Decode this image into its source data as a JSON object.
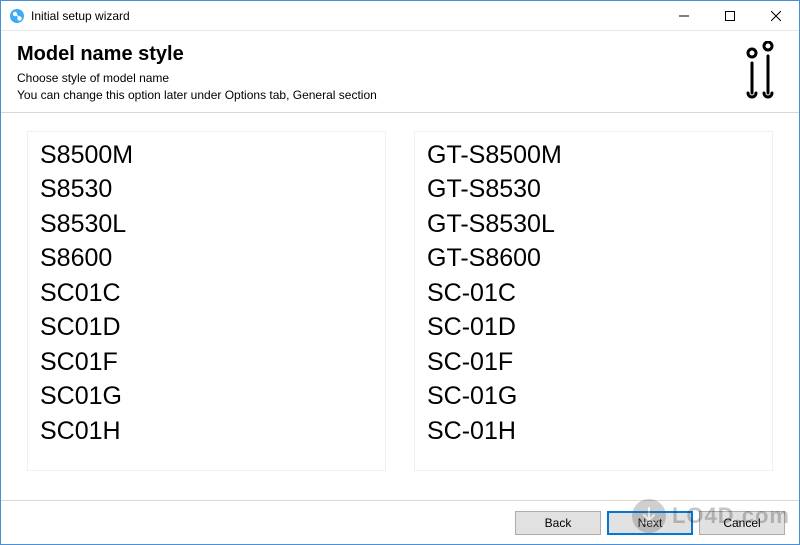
{
  "window": {
    "title": "Initial setup wizard"
  },
  "header": {
    "heading": "Model name style",
    "sub1": "Choose style of model name",
    "sub2": "You can change this option later under Options tab, General section"
  },
  "options": {
    "left": [
      "S8500M",
      "S8530",
      "S8530L",
      "S8600",
      "SC01C",
      "SC01D",
      "SC01F",
      "SC01G",
      "SC01H"
    ],
    "right": [
      "GT-S8500M",
      "GT-S8530",
      "GT-S8530L",
      "GT-S8600",
      "SC-01C",
      "SC-01D",
      "SC-01F",
      "SC-01G",
      "SC-01H"
    ]
  },
  "footer": {
    "back": "Back",
    "next": "Next",
    "cancel": "Cancel"
  },
  "watermark": {
    "text": "LO4D.com"
  }
}
